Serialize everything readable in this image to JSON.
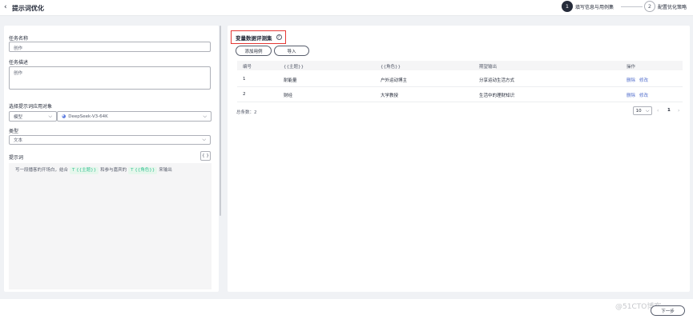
{
  "header": {
    "title": "提示词优化",
    "steps": [
      {
        "number": "1",
        "label": "填写信息与用例集"
      },
      {
        "number": "2",
        "label": "配置优化策略"
      }
    ]
  },
  "form": {
    "task_name_label": "任务名称",
    "task_name_value": "创作",
    "task_desc_label": "任务描述",
    "task_desc_value": "创作",
    "target_label": "选择提示词应用对象",
    "target_type": "模型",
    "model_name": "DeepSeek-V3-64K",
    "type_label": "类型",
    "type_value": "文本",
    "prompt_label": "提示词",
    "brace_button": "{ }",
    "prompt_text_1": "写一段播客的开场白，结合",
    "var_1": "T {{主题}}",
    "prompt_text_2": "和参与嘉宾的",
    "var_2": "T {{角色}}",
    "prompt_text_3": "来输出"
  },
  "dataset": {
    "title": "变量数据评测集",
    "add_button": "添加用例",
    "import_button": "导入",
    "columns": [
      "编号",
      "{{主题}}",
      "{{角色}}",
      "期望输出",
      "操作"
    ],
    "rows": [
      {
        "id": "1",
        "topic": "耐能量",
        "role": "户外运动博主",
        "expected": "分享运动生活方式",
        "delete": "删除",
        "edit": "修改"
      },
      {
        "id": "2",
        "topic": "财经",
        "role": "大学教授",
        "expected": "生活中的理财知识",
        "delete": "删除",
        "edit": "修改"
      }
    ],
    "total_label": "总条数：2",
    "page_size": "10",
    "current_page": "1"
  },
  "footer": {
    "next_button": "下一步",
    "watermark": "@51CTO博客"
  }
}
